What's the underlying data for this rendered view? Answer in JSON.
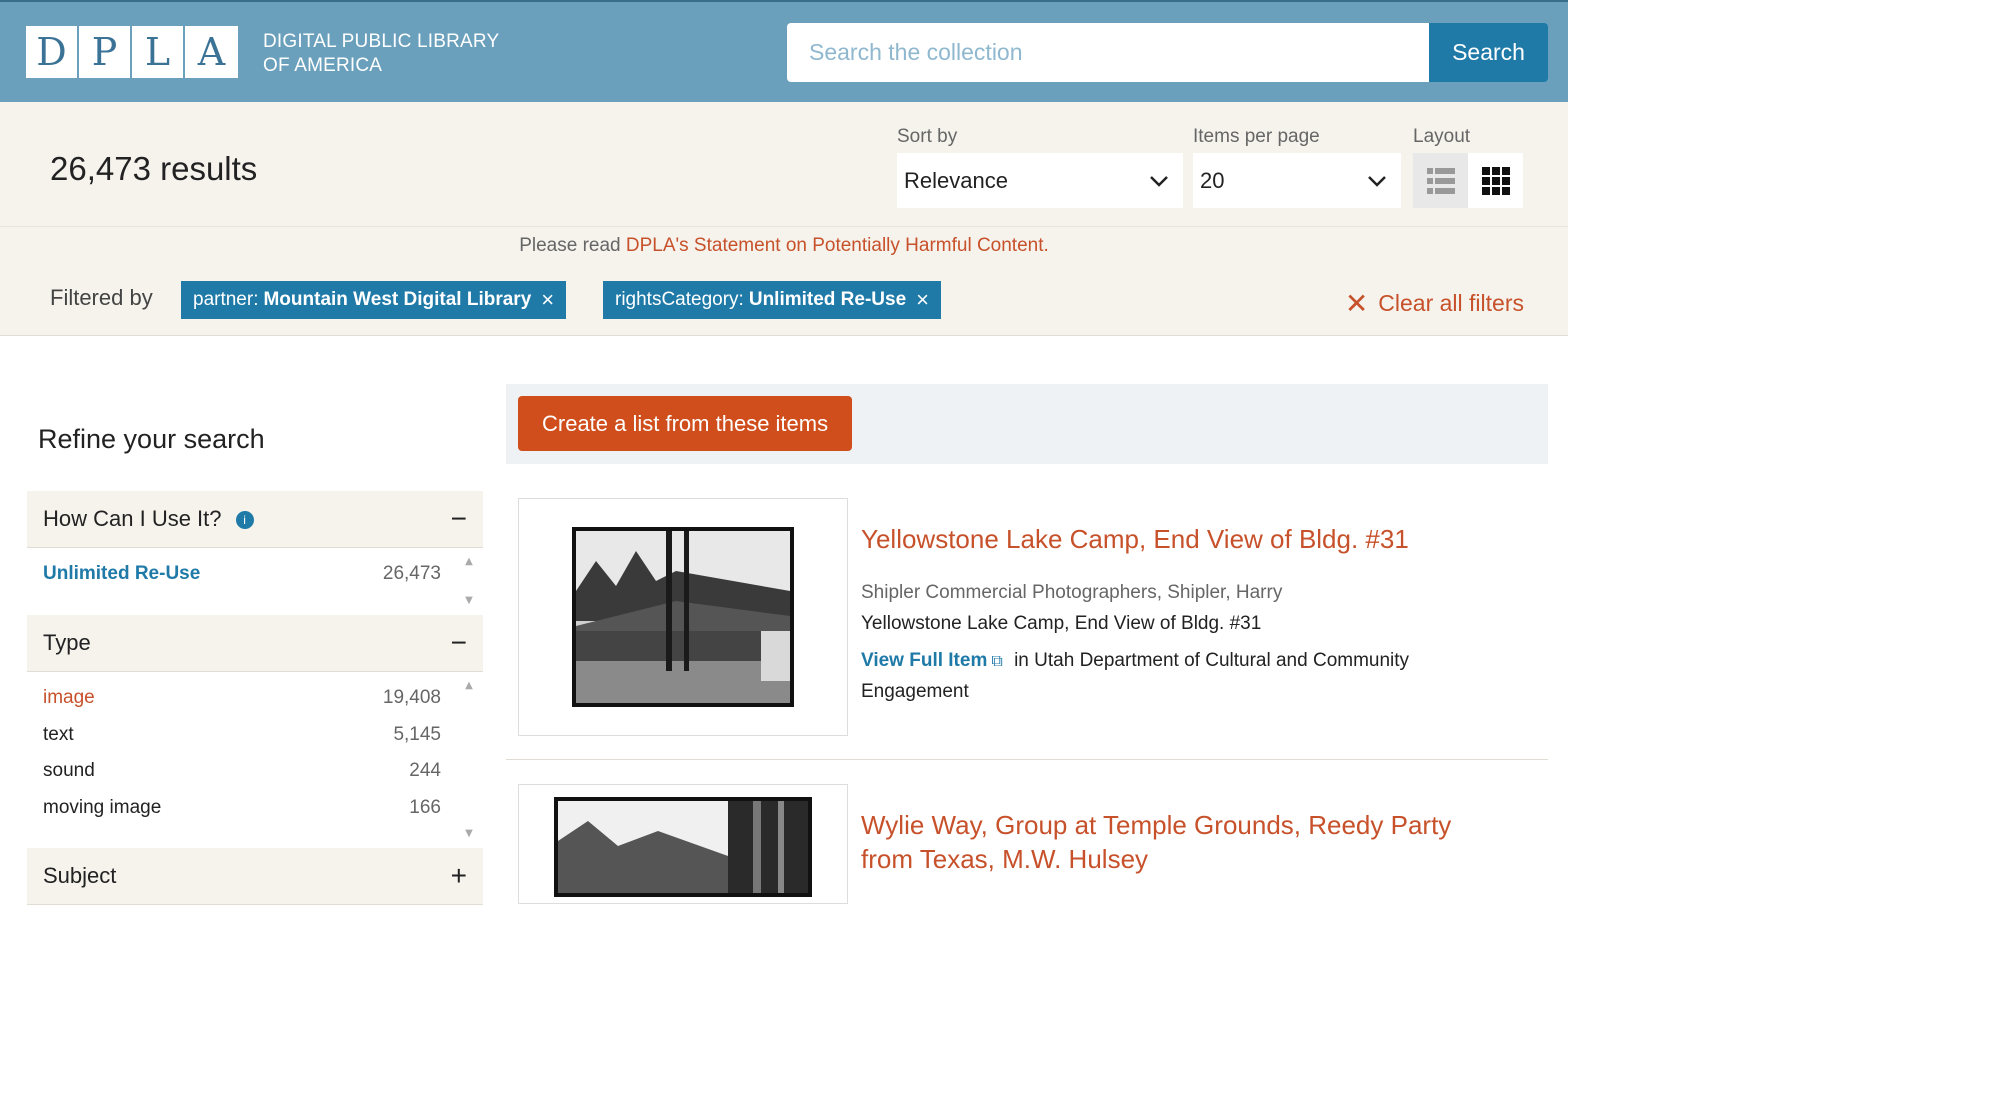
{
  "header": {
    "logo_letters": [
      "D",
      "P",
      "L",
      "A"
    ],
    "logo_line1": "DIGITAL PUBLIC LIBRARY",
    "logo_line2": "OF AMERICA",
    "search_placeholder": "Search the collection",
    "search_button": "Search"
  },
  "results": {
    "count": "26,473 results",
    "sort_label": "Sort by",
    "sort_value": "Relevance",
    "per_page_label": "Items per page",
    "per_page_value": "20",
    "layout_label": "Layout"
  },
  "notice": {
    "prefix": "Please read ",
    "link": "DPLA's Statement on Potentially Harmful Content."
  },
  "filters": {
    "label": "Filtered by",
    "chips": [
      {
        "key": "partner:",
        "value": "Mountain West Digital Library"
      },
      {
        "key": "rightsCategory:",
        "value": "Unlimited Re-Use"
      }
    ],
    "clear_all": "Clear all filters"
  },
  "sidebar": {
    "title": "Refine your search",
    "facets": [
      {
        "title": "How Can I Use It?",
        "toggle": "−",
        "rows": [
          {
            "label": "Unlimited Re-Use",
            "count": "26,473"
          }
        ]
      },
      {
        "title": "Type",
        "toggle": "−",
        "rows": [
          {
            "label": "image",
            "count": "19,408"
          },
          {
            "label": "text",
            "count": "5,145"
          },
          {
            "label": "sound",
            "count": "244"
          },
          {
            "label": "moving image",
            "count": "166"
          }
        ]
      },
      {
        "title": "Subject",
        "toggle": "+",
        "rows": []
      }
    ]
  },
  "main": {
    "create_list": "Create a list from these items",
    "items": [
      {
        "title": "Yellowstone Lake Camp, End View of Bldg. #31",
        "creator": "Shipler Commercial Photographers, Shipler, Harry",
        "description": "Yellowstone Lake Camp, End View of Bldg. #31",
        "view_label": "View Full Item",
        "provider_prefix": "in ",
        "provider": "Utah Department of Cultural and Community Engagement"
      },
      {
        "title": "Wylie Way, Group at Temple Grounds, Reedy Party from Texas, M.W. Hulsey"
      }
    ]
  },
  "colors": {
    "header_bg": "#6ba0bc",
    "accent_blue": "#1f7aa8",
    "accent_orange": "#c7512a",
    "button_orange": "#d04e1b",
    "panel_bg": "#f6f3ed"
  }
}
